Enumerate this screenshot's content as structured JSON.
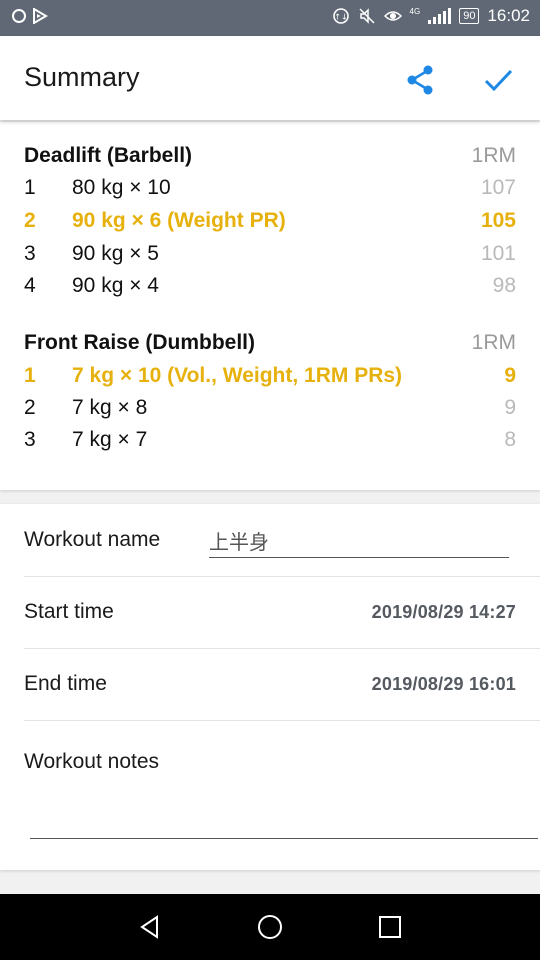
{
  "status_bar": {
    "time": "16:02",
    "battery": "90",
    "network": "4G",
    "icons": [
      "sync-circle-icon",
      "play-store-icon",
      "data-saver-icon",
      "mute-icon",
      "eye-comfort-icon",
      "signal-icon",
      "battery-icon"
    ]
  },
  "app_bar": {
    "title": "Summary",
    "share_icon": "share-icon",
    "confirm_icon": "check-icon",
    "accent_color": "#1e88e5"
  },
  "exercises": [
    {
      "name": "Deadlift (Barbell)",
      "rm_label": "1RM",
      "sets": [
        {
          "num": "1",
          "desc": "80 kg × 10",
          "rm": "107",
          "pr": false
        },
        {
          "num": "2",
          "desc": "90 kg × 6 (Weight PR)",
          "rm": "105",
          "pr": true
        },
        {
          "num": "3",
          "desc": "90 kg × 5",
          "rm": "101",
          "pr": false
        },
        {
          "num": "4",
          "desc": "90 kg × 4",
          "rm": "98",
          "pr": false
        }
      ]
    },
    {
      "name": "Front Raise (Dumbbell)",
      "rm_label": "1RM",
      "sets": [
        {
          "num": "1",
          "desc": "7 kg × 10 (Vol., Weight, 1RM PRs)",
          "rm": "9",
          "pr": true
        },
        {
          "num": "2",
          "desc": "7 kg × 8",
          "rm": "9",
          "pr": false
        },
        {
          "num": "3",
          "desc": "7 kg × 7",
          "rm": "8",
          "pr": false
        }
      ]
    }
  ],
  "details": {
    "workout_name_label": "Workout name",
    "workout_name_value": "上半身",
    "start_time_label": "Start time",
    "start_time_value": "2019/08/29 14:27",
    "end_time_label": "End time",
    "end_time_value": "2019/08/29 16:01",
    "notes_label": "Workout notes",
    "notes_value": ""
  },
  "nav_bar": {
    "icons": [
      "back-icon",
      "home-icon",
      "recents-icon"
    ]
  },
  "colors": {
    "pr_color": "#e7b10d",
    "status_bar": "#5f6874"
  }
}
